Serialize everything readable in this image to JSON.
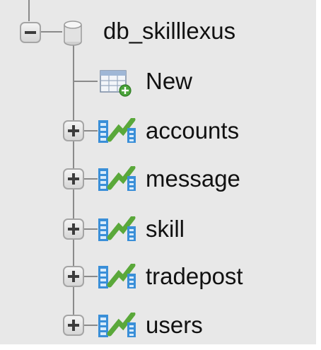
{
  "tree": {
    "database": {
      "name": "db_skilllexus",
      "icon": "database-icon",
      "expanded": true
    },
    "new_item": {
      "label": "New",
      "icon": "new-table-icon"
    },
    "tables": [
      {
        "name": "accounts",
        "icon": "table-icon",
        "expanded": false
      },
      {
        "name": "message",
        "icon": "table-icon",
        "expanded": false
      },
      {
        "name": "skill",
        "icon": "table-icon",
        "expanded": false
      },
      {
        "name": "tradepost",
        "icon": "table-icon",
        "expanded": false
      },
      {
        "name": "users",
        "icon": "table-icon",
        "expanded": false
      }
    ]
  },
  "colors": {
    "panel_background": "#e8e8e8",
    "tree_line": "#8a8a8a",
    "table_icon_blue": "#3a8fd8",
    "table_icon_green": "#5aa83a"
  }
}
